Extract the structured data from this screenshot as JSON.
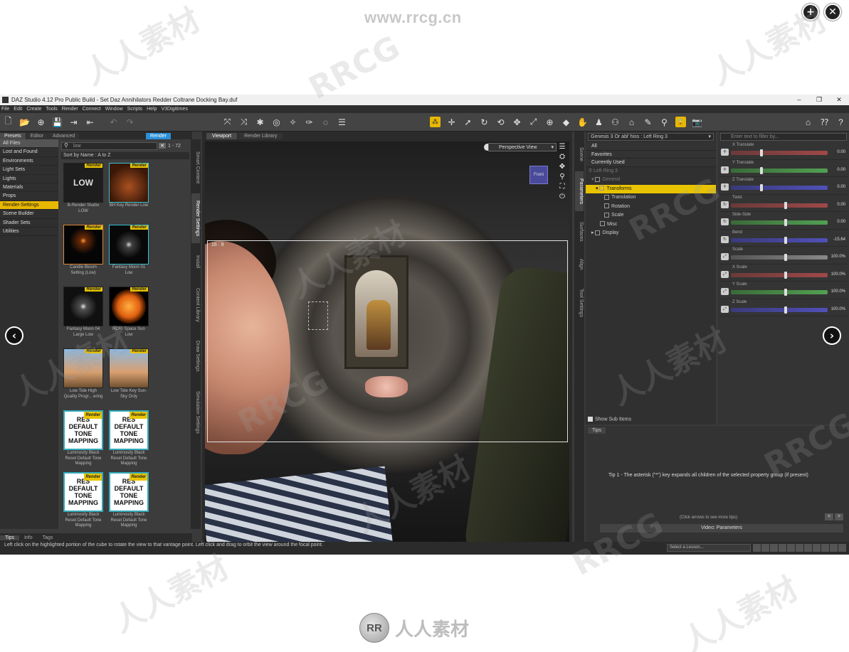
{
  "overlay": {
    "site_url": "www.rrcg.cn",
    "zoom_icon": "magnifier-plus-icon",
    "close_icon": "close-icon",
    "prev_icon": "chevron-left-icon",
    "next_icon": "chevron-right-icon",
    "footer_logo_text": "人人素材",
    "footer_logo_mark": "RR",
    "watermark_cn": "人人素材",
    "watermark_en": "RRCG"
  },
  "window": {
    "title": "DAZ Studio 4.12 Pro Public Build - Set Daz Annihilators Redder Coltrane Docking Bay.duf",
    "min": "–",
    "max": "❐",
    "close": "✕"
  },
  "menu": [
    "File",
    "Edit",
    "Create",
    "Tools",
    "Render",
    "Connect",
    "Window",
    "Scripts",
    "Help",
    "V3Digitimes"
  ],
  "content_library": {
    "tabs": [
      "Presets",
      "Editor",
      "Advanced"
    ],
    "render_button": "Render",
    "categories": [
      "All Files",
      "Lost and Found",
      "Environments",
      "Light Sets",
      "Lights",
      "Materials",
      "Props",
      "Render-Settings",
      "Scene Builder",
      "Shader Sets",
      "Utilities"
    ],
    "active_category": "Render-Settings",
    "search_value": "low",
    "result_count": "1 - 72",
    "sort_label": "Sort by Name : A to Z",
    "badge_label": "Render",
    "thumbnails": [
      {
        "caption": "B-Render Studio LOW",
        "art": "LOW"
      },
      {
        "caption": "BH Key Render Low",
        "art": ""
      },
      {
        "caption": "Candle Bloom Setting (Low)",
        "art": ""
      },
      {
        "caption": "Fantasy Moon 01 Low",
        "art": ""
      },
      {
        "caption": "Fantasy Moon 04 Large Low",
        "art": ""
      },
      {
        "caption": "HDRI Space Sun Low",
        "art": ""
      },
      {
        "caption": "Low Tide High Quality Progr... ering",
        "art": ""
      },
      {
        "caption": "Low Tide Key Sun-Sky Only",
        "art": ""
      },
      {
        "caption": "Luminosity Black Reset Default Tone Mapping",
        "art": "RES DEFAULT TONE MAPPING"
      },
      {
        "caption": "Luminosity Black Reset Default Tone Mapping",
        "art": "RES DEFAULT TONE MAPPING"
      },
      {
        "caption": "Luminosity Black Reset Default Tone Mapping",
        "art": "RES DEFAULT TONE MAPPING"
      },
      {
        "caption": "Luminosity Black Reset Default Tone Mapping",
        "art": "RES DEFAULT TONE MAPPING"
      }
    ],
    "side_tabs": [
      "Smart Content",
      "Render Settings",
      "Install",
      "Content Library",
      "Draw Settings",
      "Simulation Settings"
    ],
    "bottom_tabs": [
      "Tips",
      "Info",
      "Tags"
    ]
  },
  "viewport": {
    "tabs": [
      "Viewport",
      "Render Library"
    ],
    "view_mode": "Perspective View",
    "aspect_label": "16 : 9",
    "cube_label": "Front"
  },
  "right_side_tabs": [
    "Scene",
    "Parameters",
    "Surfaces",
    "Align",
    "Tool Settings"
  ],
  "scene_tree": {
    "node_selector": "Genesis 3 Or abl' hiss : Left Ring 3",
    "filters": [
      "All",
      "Favorites",
      "Currently Used"
    ],
    "rows": [
      {
        "label": "Left Ring 3",
        "indent": 4,
        "style": "dim"
      },
      {
        "label": "General",
        "indent": 8,
        "style": "dim"
      },
      {
        "label": "Transforms",
        "indent": 14,
        "style": "sel"
      },
      {
        "label": "Translation",
        "indent": 26,
        "style": ""
      },
      {
        "label": "Rotation",
        "indent": 26,
        "style": ""
      },
      {
        "label": "Scale",
        "indent": 26,
        "style": ""
      },
      {
        "label": "Misc",
        "indent": 20,
        "style": ""
      },
      {
        "label": "Display",
        "indent": 8,
        "style": ""
      }
    ],
    "show_sub_items": "Show Sub Items"
  },
  "parameters": {
    "search_placeholder": "Enter text to filter by...",
    "items": [
      {
        "name": "X Translate",
        "value": "0.00",
        "color": "red",
        "pos": 0.3
      },
      {
        "name": "Y Translate",
        "value": "0.00",
        "color": "green",
        "pos": 0.3
      },
      {
        "name": "Z Translate",
        "value": "0.00",
        "color": "blue",
        "pos": 0.3
      },
      {
        "name": "Twist",
        "value": "0.00",
        "color": "red",
        "pos": 0.55
      },
      {
        "name": "Side-Side",
        "value": "0.00",
        "color": "green",
        "pos": 0.55
      },
      {
        "name": "Bend",
        "value": "-15.64",
        "color": "blue",
        "pos": 0.55
      },
      {
        "name": "Scale",
        "value": "100.0%",
        "color": "grey",
        "pos": 0.55
      },
      {
        "name": "X Scale",
        "value": "100.0%",
        "color": "red",
        "pos": 0.55
      },
      {
        "name": "Y Scale",
        "value": "100.0%",
        "color": "green",
        "pos": 0.55
      },
      {
        "name": "Z Scale",
        "value": "100.0%",
        "color": "blue",
        "pos": 0.55
      }
    ]
  },
  "tips": {
    "tab": "Tips",
    "text": "Tip 1 - The asterisk (\"*\") key expands all children of the selected property group (if present)",
    "hint": "(Click arrows to see more tips)",
    "prev": "<",
    "next": ">",
    "video_button": "Video: Parameters"
  },
  "status": {
    "text": "Left click on the highlighted portion of the cube to rotate the view to that vantage point. Left click and drag to orbit the view around the focal point.",
    "lesson_placeholder": "Select a Lesson..."
  }
}
